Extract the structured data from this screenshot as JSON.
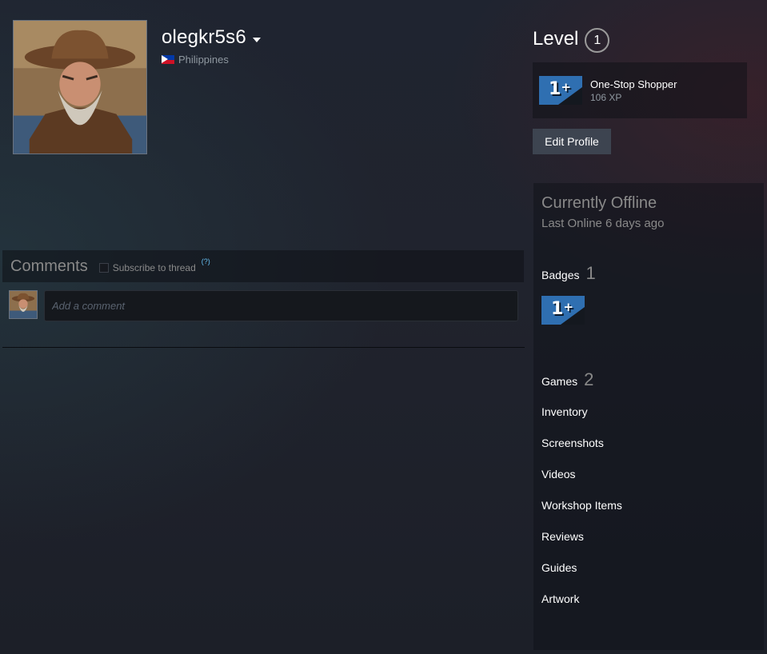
{
  "profile": {
    "persona_name": "olegkr5s6",
    "location": "Philippines"
  },
  "level": {
    "label": "Level",
    "value": "1"
  },
  "favorite_badge": {
    "name": "One-Stop Shopper",
    "xp": "106 XP",
    "icon_text": "1",
    "icon_plus": "+"
  },
  "actions": {
    "edit_profile": "Edit Profile"
  },
  "status": {
    "title": "Currently Offline",
    "last_online": "Last Online 6 days ago"
  },
  "badges": {
    "label": "Badges",
    "count": "1"
  },
  "games": {
    "label": "Games",
    "count": "2"
  },
  "links": [
    "Inventory",
    "Screenshots",
    "Videos",
    "Workshop Items",
    "Reviews",
    "Guides",
    "Artwork"
  ],
  "comments": {
    "title": "Comments",
    "subscribe_label": "Subscribe to thread",
    "help": "(?)",
    "placeholder": "Add a comment"
  },
  "colors": {
    "accent_link": "#66c0f4",
    "badge_blue": "#2f6fb1",
    "button_bg": "#3d4450"
  },
  "icons": {
    "flag": "philippines-flag-icon",
    "caret": "chevron-down-icon",
    "badge": "one-plus-badge-icon"
  }
}
